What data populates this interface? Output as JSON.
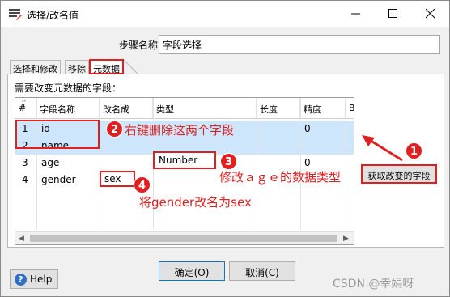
{
  "window": {
    "title": "选择/改名值",
    "controls": {
      "minimize": "minimize",
      "maximize": "maximize",
      "close": "close"
    }
  },
  "step": {
    "label": "步骤名称",
    "value": "字段选择"
  },
  "tabs": [
    {
      "label": "选择和修改",
      "active": false
    },
    {
      "label": "移除",
      "active": false
    },
    {
      "label": "元数据",
      "active": true
    }
  ],
  "panel": {
    "caption": "需要改变元数据的字段："
  },
  "grid": {
    "columns": [
      "#",
      "字段名称",
      "改名成",
      "类型",
      "长度",
      "精度",
      "B"
    ],
    "rows": [
      {
        "num": "1",
        "name": "id",
        "rename": "",
        "type": "",
        "length": "",
        "precision": "0"
      },
      {
        "num": "2",
        "name": "name",
        "rename": "",
        "type": "",
        "length": "",
        "precision": ""
      },
      {
        "num": "3",
        "name": "age",
        "rename": "",
        "type": "Number",
        "length": "",
        "precision": "0"
      },
      {
        "num": "4",
        "name": "gender",
        "rename": "sex",
        "type": "",
        "length": "",
        "precision": ""
      }
    ]
  },
  "buttons": {
    "get_fields": "获取改变的字段",
    "ok": "确定(O)",
    "cancel": "取消(C)",
    "help": "Help"
  },
  "annotations": {
    "1": {
      "badge": "1"
    },
    "2": {
      "badge": "2",
      "text": "右键删除这两个字段"
    },
    "3": {
      "badge": "3",
      "text": "修改ａｇｅ的数据类型"
    },
    "4": {
      "badge": "4",
      "text": "将gender改名为sex"
    }
  },
  "watermark": "CSDN @幸娟呀",
  "colors": {
    "annotation_red": "#e02020",
    "selection": "#cde6fb",
    "help_blue": "#2f6fc4"
  }
}
